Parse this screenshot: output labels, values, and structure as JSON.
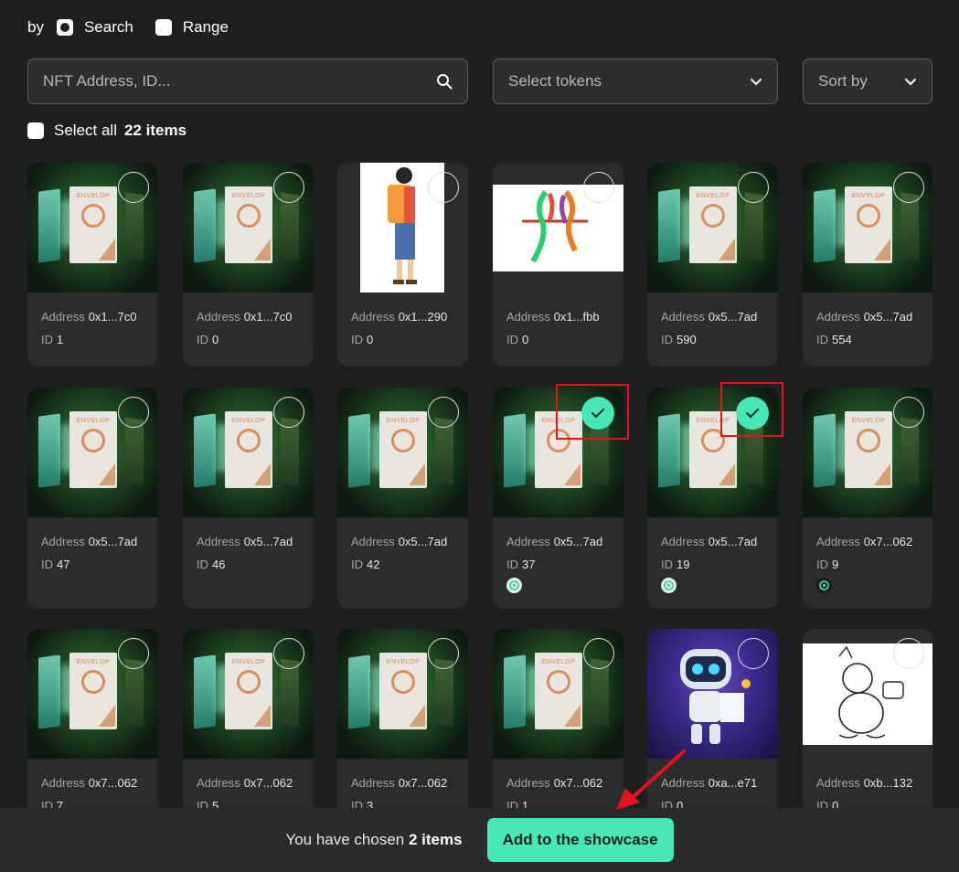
{
  "filter": {
    "by_label": "by",
    "options": [
      {
        "label": "Search",
        "selected": true
      },
      {
        "label": "Range",
        "selected": false
      }
    ]
  },
  "search": {
    "placeholder": "NFT Address, ID..."
  },
  "tokens_select": {
    "placeholder": "Select tokens"
  },
  "sort_select": {
    "label": "Sort by"
  },
  "select_all": {
    "label": "Select all",
    "count": "22 items"
  },
  "address_label": "Address",
  "id_label": "ID",
  "cards": [
    {
      "image": "envelop",
      "address": "0x1...7c0",
      "id": "1",
      "checked": false
    },
    {
      "image": "envelop",
      "address": "0x1...7c0",
      "id": "0",
      "checked": false
    },
    {
      "image": "backpacker",
      "address": "0x1...290",
      "id": "0",
      "checked": false
    },
    {
      "image": "parrots",
      "address": "0x1...fbb",
      "id": "0",
      "checked": false
    },
    {
      "image": "envelop",
      "address": "0x5...7ad",
      "id": "590",
      "checked": false
    },
    {
      "image": "envelop",
      "address": "0x5...7ad",
      "id": "554",
      "checked": false
    },
    {
      "image": "envelop",
      "address": "0x5...7ad",
      "id": "47",
      "checked": false
    },
    {
      "image": "envelop",
      "address": "0x5...7ad",
      "id": "46",
      "checked": false
    },
    {
      "image": "envelop",
      "address": "0x5...7ad",
      "id": "42",
      "checked": false
    },
    {
      "image": "envelop",
      "address": "0x5...7ad",
      "id": "37",
      "checked": true,
      "token_icon": "light"
    },
    {
      "image": "envelop",
      "address": "0x5...7ad",
      "id": "19",
      "checked": true,
      "token_icon": "light"
    },
    {
      "image": "envelop",
      "address": "0x7...062",
      "id": "9",
      "checked": false,
      "token_icon": "dark"
    },
    {
      "image": "envelop",
      "address": "0x7...062",
      "id": "7",
      "checked": false
    },
    {
      "image": "envelop",
      "address": "0x7...062",
      "id": "5",
      "checked": false
    },
    {
      "image": "envelop",
      "address": "0x7...062",
      "id": "3",
      "checked": false
    },
    {
      "image": "envelop",
      "address": "0x7...062",
      "id": "1",
      "checked": false
    },
    {
      "image": "robot",
      "address": "0xa...e71",
      "id": "0",
      "checked": false
    },
    {
      "image": "bear-sketch",
      "address": "0xb...132",
      "id": "0",
      "checked": false
    }
  ],
  "bottom": {
    "message_prefix": "You have chosen",
    "message_count": "2 items",
    "button_label": "Add to the showcase"
  },
  "colors": {
    "background": "#1e1f1f",
    "card": "#2b2c2d",
    "accent": "#48e8b6",
    "highlight": "#e0141a"
  }
}
